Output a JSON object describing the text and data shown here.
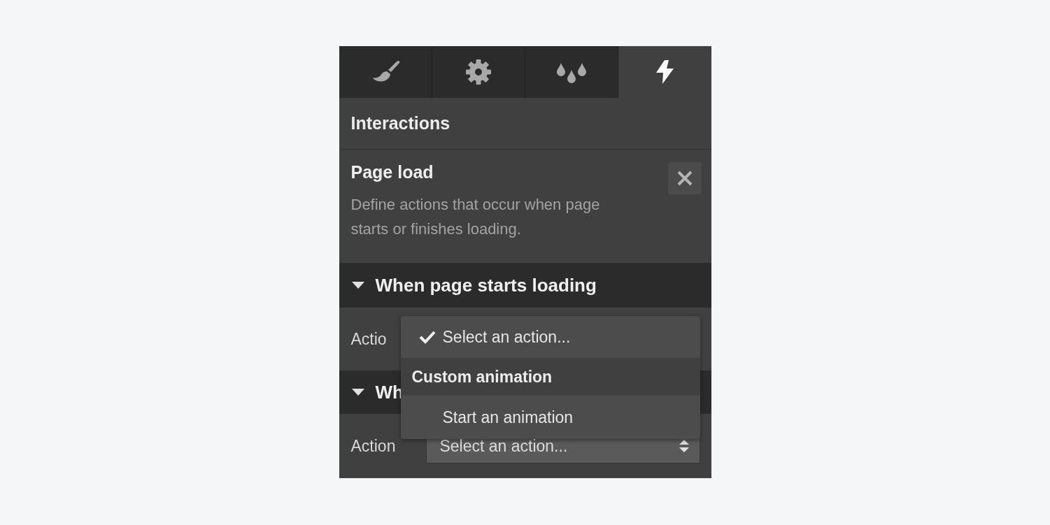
{
  "tabs": [
    {
      "kind": "brush",
      "selected": false
    },
    {
      "kind": "gear",
      "selected": false
    },
    {
      "kind": "drops",
      "selected": false
    },
    {
      "kind": "bolt",
      "selected": true
    }
  ],
  "panel_title": "Interactions",
  "trigger": {
    "title": "Page load",
    "description": "Define actions that occur when page starts or finishes loading."
  },
  "sections": [
    {
      "title": "When page starts loading",
      "expanded": true,
      "action_label": "Actio"
    },
    {
      "title": "Wh",
      "expanded": true,
      "action_label": "Action",
      "select_value": "Select an action..."
    }
  ],
  "dropdown": {
    "items": [
      {
        "kind": "option",
        "label": "Select an action...",
        "selected": true
      },
      {
        "kind": "group",
        "label": "Custom animation"
      },
      {
        "kind": "option",
        "label": "Start an animation",
        "selected": false
      }
    ]
  }
}
